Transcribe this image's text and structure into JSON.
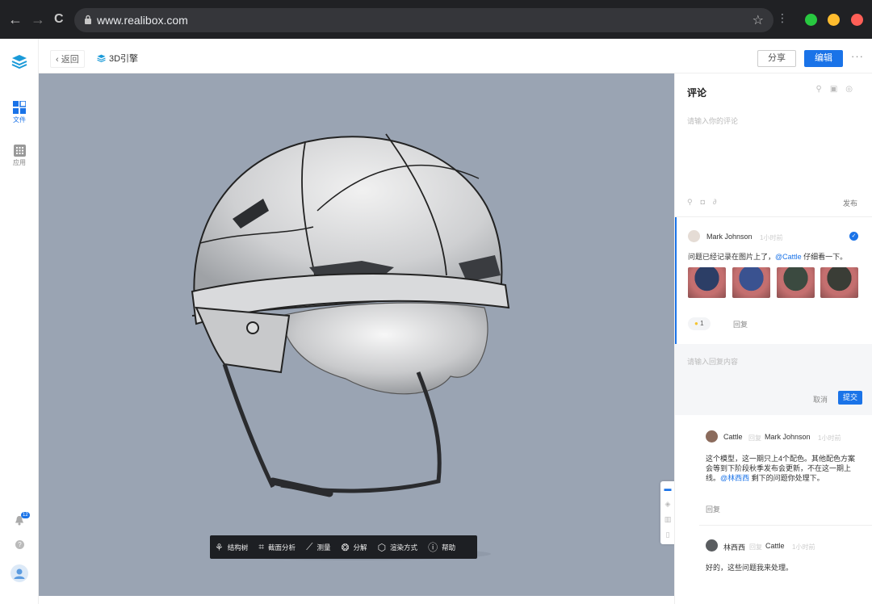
{
  "browser": {
    "url": "www.realibox.com",
    "back_glyph": "←",
    "forward_glyph": "→",
    "reload_glyph": "C",
    "star_glyph": "☆",
    "menu_glyph": "⋮",
    "traffic_lights": [
      "#28c840",
      "#febc2e",
      "#ff5f57"
    ]
  },
  "sidebar": {
    "items": [
      {
        "label": "文件",
        "icon": "grid-icon"
      },
      {
        "label": "应用",
        "icon": "apps-icon"
      }
    ],
    "notification_count": "12"
  },
  "topbar": {
    "back_label": "返回",
    "breadcrumb": "3D引擎",
    "share_label": "分享",
    "edit_label": "编辑",
    "more_glyph": "···"
  },
  "toolbar": {
    "items": [
      {
        "label": "结构树",
        "icon": "tree-icon"
      },
      {
        "label": "截面分析",
        "icon": "crop-icon"
      },
      {
        "label": "测量",
        "icon": "ruler-icon"
      },
      {
        "label": "分解",
        "icon": "explode-icon"
      },
      {
        "label": "渲染方式",
        "icon": "cube-icon"
      },
      {
        "label": "帮助",
        "icon": "help-icon"
      }
    ]
  },
  "comments": {
    "title": "评论",
    "input_placeholder": "请输入你的评论",
    "publish_label": "发布",
    "thread": {
      "author": "Mark Johnson",
      "time": "1小时前",
      "text_before": "问题已经记录在图片上了，",
      "mention": "@Cattle",
      "text_after": " 仔细看一下。",
      "thumb_colors": [
        "#2c3e66",
        "#3a5290",
        "#3b4a40",
        "#3a3d36"
      ],
      "likes": "1",
      "reply_label": "回复"
    },
    "reply_box": {
      "placeholder": "请输入回复内容",
      "cancel_label": "取消",
      "submit_label": "提交"
    },
    "replies": [
      {
        "author": "Cattle",
        "reply_word": "回复",
        "target": "Mark Johnson",
        "time": "1小时前",
        "line1": "这个模型，这一期只上4个配色。其他配色方案",
        "line2": "会等到下阶段秋季发布会更新，不在这一期上",
        "line3_pre": "线。",
        "mention": "@林西西",
        "line3_post": " 剩下的问题你处理下。",
        "reply_label": "回复"
      },
      {
        "author": "林西西",
        "reply_word": "回复",
        "target": "Cattle",
        "time": "1小时前",
        "text": "好的，这些问题我来处理。"
      }
    ]
  }
}
